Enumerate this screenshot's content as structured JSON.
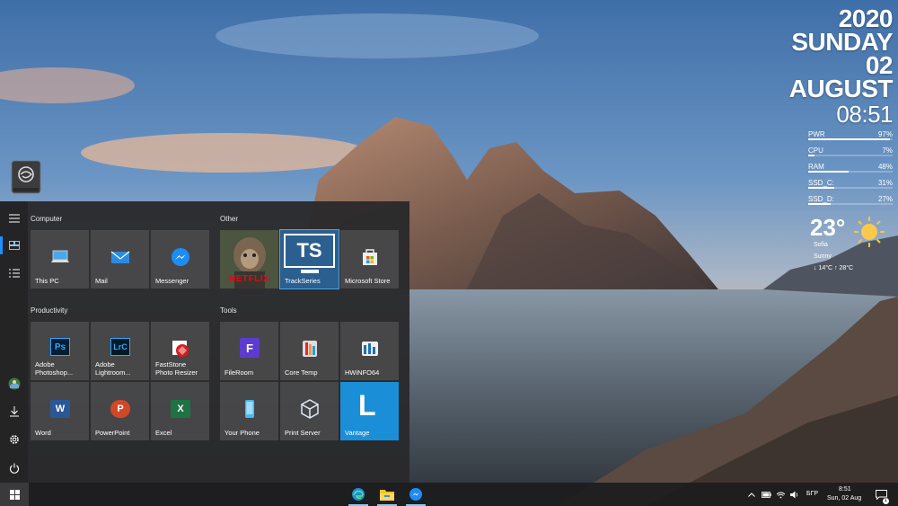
{
  "widget": {
    "year": "2020",
    "weekday": "SUNDAY",
    "day": "02",
    "month": "AUGUST",
    "time": "08:51",
    "meters": [
      {
        "label": "PWR",
        "value": "97%",
        "level": 0.97
      },
      {
        "label": "CPU",
        "value": "7%",
        "level": 0.07
      },
      {
        "label": "RAM",
        "value": "48%",
        "level": 0.48
      },
      {
        "label": "SSD_C:",
        "value": "31%",
        "level": 0.31
      },
      {
        "label": "SSD_D:",
        "value": "27%",
        "level": 0.27
      }
    ],
    "weather": {
      "temp": "23°",
      "city": "Sofia",
      "condition": "Sunny",
      "low_high": "↓ 14°C    ↑ 28°C",
      "icon": "sun-icon"
    }
  },
  "start_menu": {
    "rail": {
      "menu_icon": "hamburger-icon",
      "tiles_icon": "tiles-icon",
      "list_icon": "all-apps-icon",
      "user_icon": "user-avatar-icon",
      "downloads_icon": "download-icon",
      "settings_icon": "gear-icon",
      "power_icon": "power-icon"
    },
    "groups": {
      "computer": "Computer",
      "other": "Other",
      "productivity": "Productivity",
      "tools": "Tools"
    },
    "tiles": {
      "this_pc": "This PC",
      "mail": "Mail",
      "messenger": "Messenger",
      "netflix": "NETFLIX",
      "trackseries": "TrackSeries",
      "trackseries_logo": "TS",
      "ms_store": "Microsoft Store",
      "photoshop": "Adobe\nPhotoshop...",
      "lightroom": "Adobe\nLightroom...",
      "faststone": "FastStone\nPhoto Resizer",
      "fileroom": "FileRoom",
      "coretemp": "Core Temp",
      "hwinfo": "HWiNFO64",
      "word": "Word",
      "powerpoint": "PowerPoint",
      "excel": "Excel",
      "yourphone": "Your Phone",
      "printserver": "Print Server",
      "vantage": "Vantage",
      "ps_glyph": "Ps",
      "lrc_glyph": "LrC",
      "fileroom_glyph": "F",
      "word_glyph": "W",
      "ppt_glyph": "P",
      "excel_glyph": "X",
      "vantage_glyph": "L"
    }
  },
  "taskbar": {
    "start_icon": "windows-logo-icon",
    "apps": [
      "edge-icon",
      "file-explorer-icon",
      "messenger-icon"
    ],
    "tray": {
      "lang": "БГР",
      "time": "8:51",
      "date": "Sun, 02 Aug",
      "notifications": "1"
    }
  },
  "colors": {
    "accent": "#1a8fd8",
    "start_bg": "#2a2a2c",
    "tile_bg": "#505052"
  }
}
